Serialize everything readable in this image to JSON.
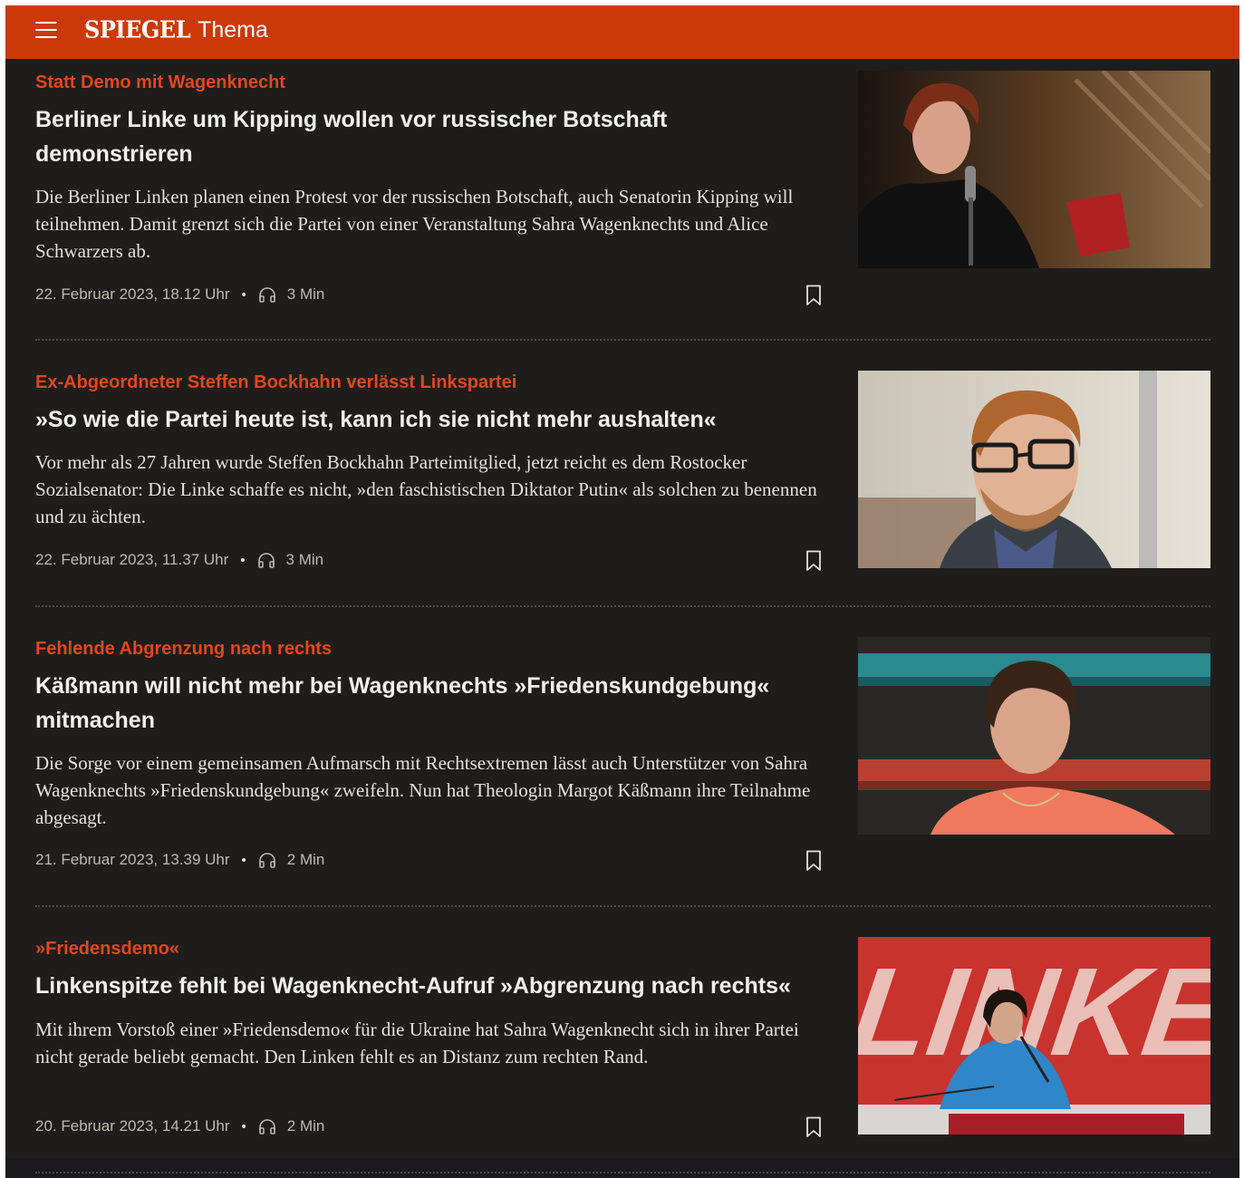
{
  "header": {
    "brand": "SPIEGEL",
    "section": "Thema",
    "menu_icon": "hamburger-menu-icon",
    "color": "#cc3908"
  },
  "colors": {
    "background": "#1e1d1b",
    "kicker": "#e2471b",
    "headline": "#f2f1ee",
    "meta": "#bdbab4"
  },
  "articles": [
    {
      "kicker": "Statt Demo mit Wagenknecht",
      "headline": "Berliner Linke um Kipping wollen vor russischer Botschaft demonstrieren",
      "teaser": "Die Berliner Linken planen einen Protest vor der russischen Botschaft, auch Senatorin Kipping will teilnehmen. Damit grenzt sich die Partei von einer Veranstaltung Sahra Wagenknechts und Alice Schwarzers ab.",
      "date": "22. Februar 2023, 18.12 Uhr",
      "separator": "•",
      "read_time": "3 Min",
      "audio_icon": "headphones-icon",
      "bookmark_icon": "bookmark-icon"
    },
    {
      "kicker": "Ex-Abgeordneter Steffen Bockhahn verlässt Linkspartei",
      "headline": "»So wie die Partei heute ist, kann ich sie nicht mehr aushalten«",
      "teaser": "Vor mehr als 27 Jahren wurde Steffen Bockhahn Parteimitglied, jetzt reicht es dem Rostocker Sozialsenator: Die Linke schaffe es nicht, »den faschistischen Diktator Putin« als solchen zu benennen und zu ächten.",
      "date": "22. Februar 2023, 11.37 Uhr",
      "separator": "•",
      "read_time": "3 Min",
      "audio_icon": "headphones-icon",
      "bookmark_icon": "bookmark-icon"
    },
    {
      "kicker": "Fehlende Abgrenzung nach rechts",
      "headline": "Käßmann will nicht mehr bei Wagenknechts »Friedenskundgebung« mitmachen",
      "teaser": "Die Sorge vor einem gemeinsamen Aufmarsch mit Rechtsextremen lässt auch Unterstützer von Sahra Wagenknechts »Friedenskundgebung« zweifeln. Nun hat Theologin Margot Käßmann ihre Teilnahme abgesagt.",
      "date": "21. Februar 2023, 13.39 Uhr",
      "separator": "•",
      "read_time": "2 Min",
      "audio_icon": "headphones-icon",
      "bookmark_icon": "bookmark-icon"
    },
    {
      "kicker": "»Friedensdemo«",
      "headline": "Linkenspitze fehlt bei Wagenknecht-Aufruf »Abgrenzung nach rechts«",
      "teaser": "Mit ihrem Vorstoß einer »Friedensdemo« für die Ukraine hat Sahra Wagenknecht sich in ihrer Partei nicht gerade beliebt gemacht. Den Linken fehlt es an Distanz zum rechten Rand.",
      "date": "20. Februar 2023, 14.21 Uhr",
      "separator": "•",
      "read_time": "2 Min",
      "audio_icon": "headphones-icon",
      "bookmark_icon": "bookmark-icon",
      "image_banner_text": "LINKE."
    }
  ]
}
